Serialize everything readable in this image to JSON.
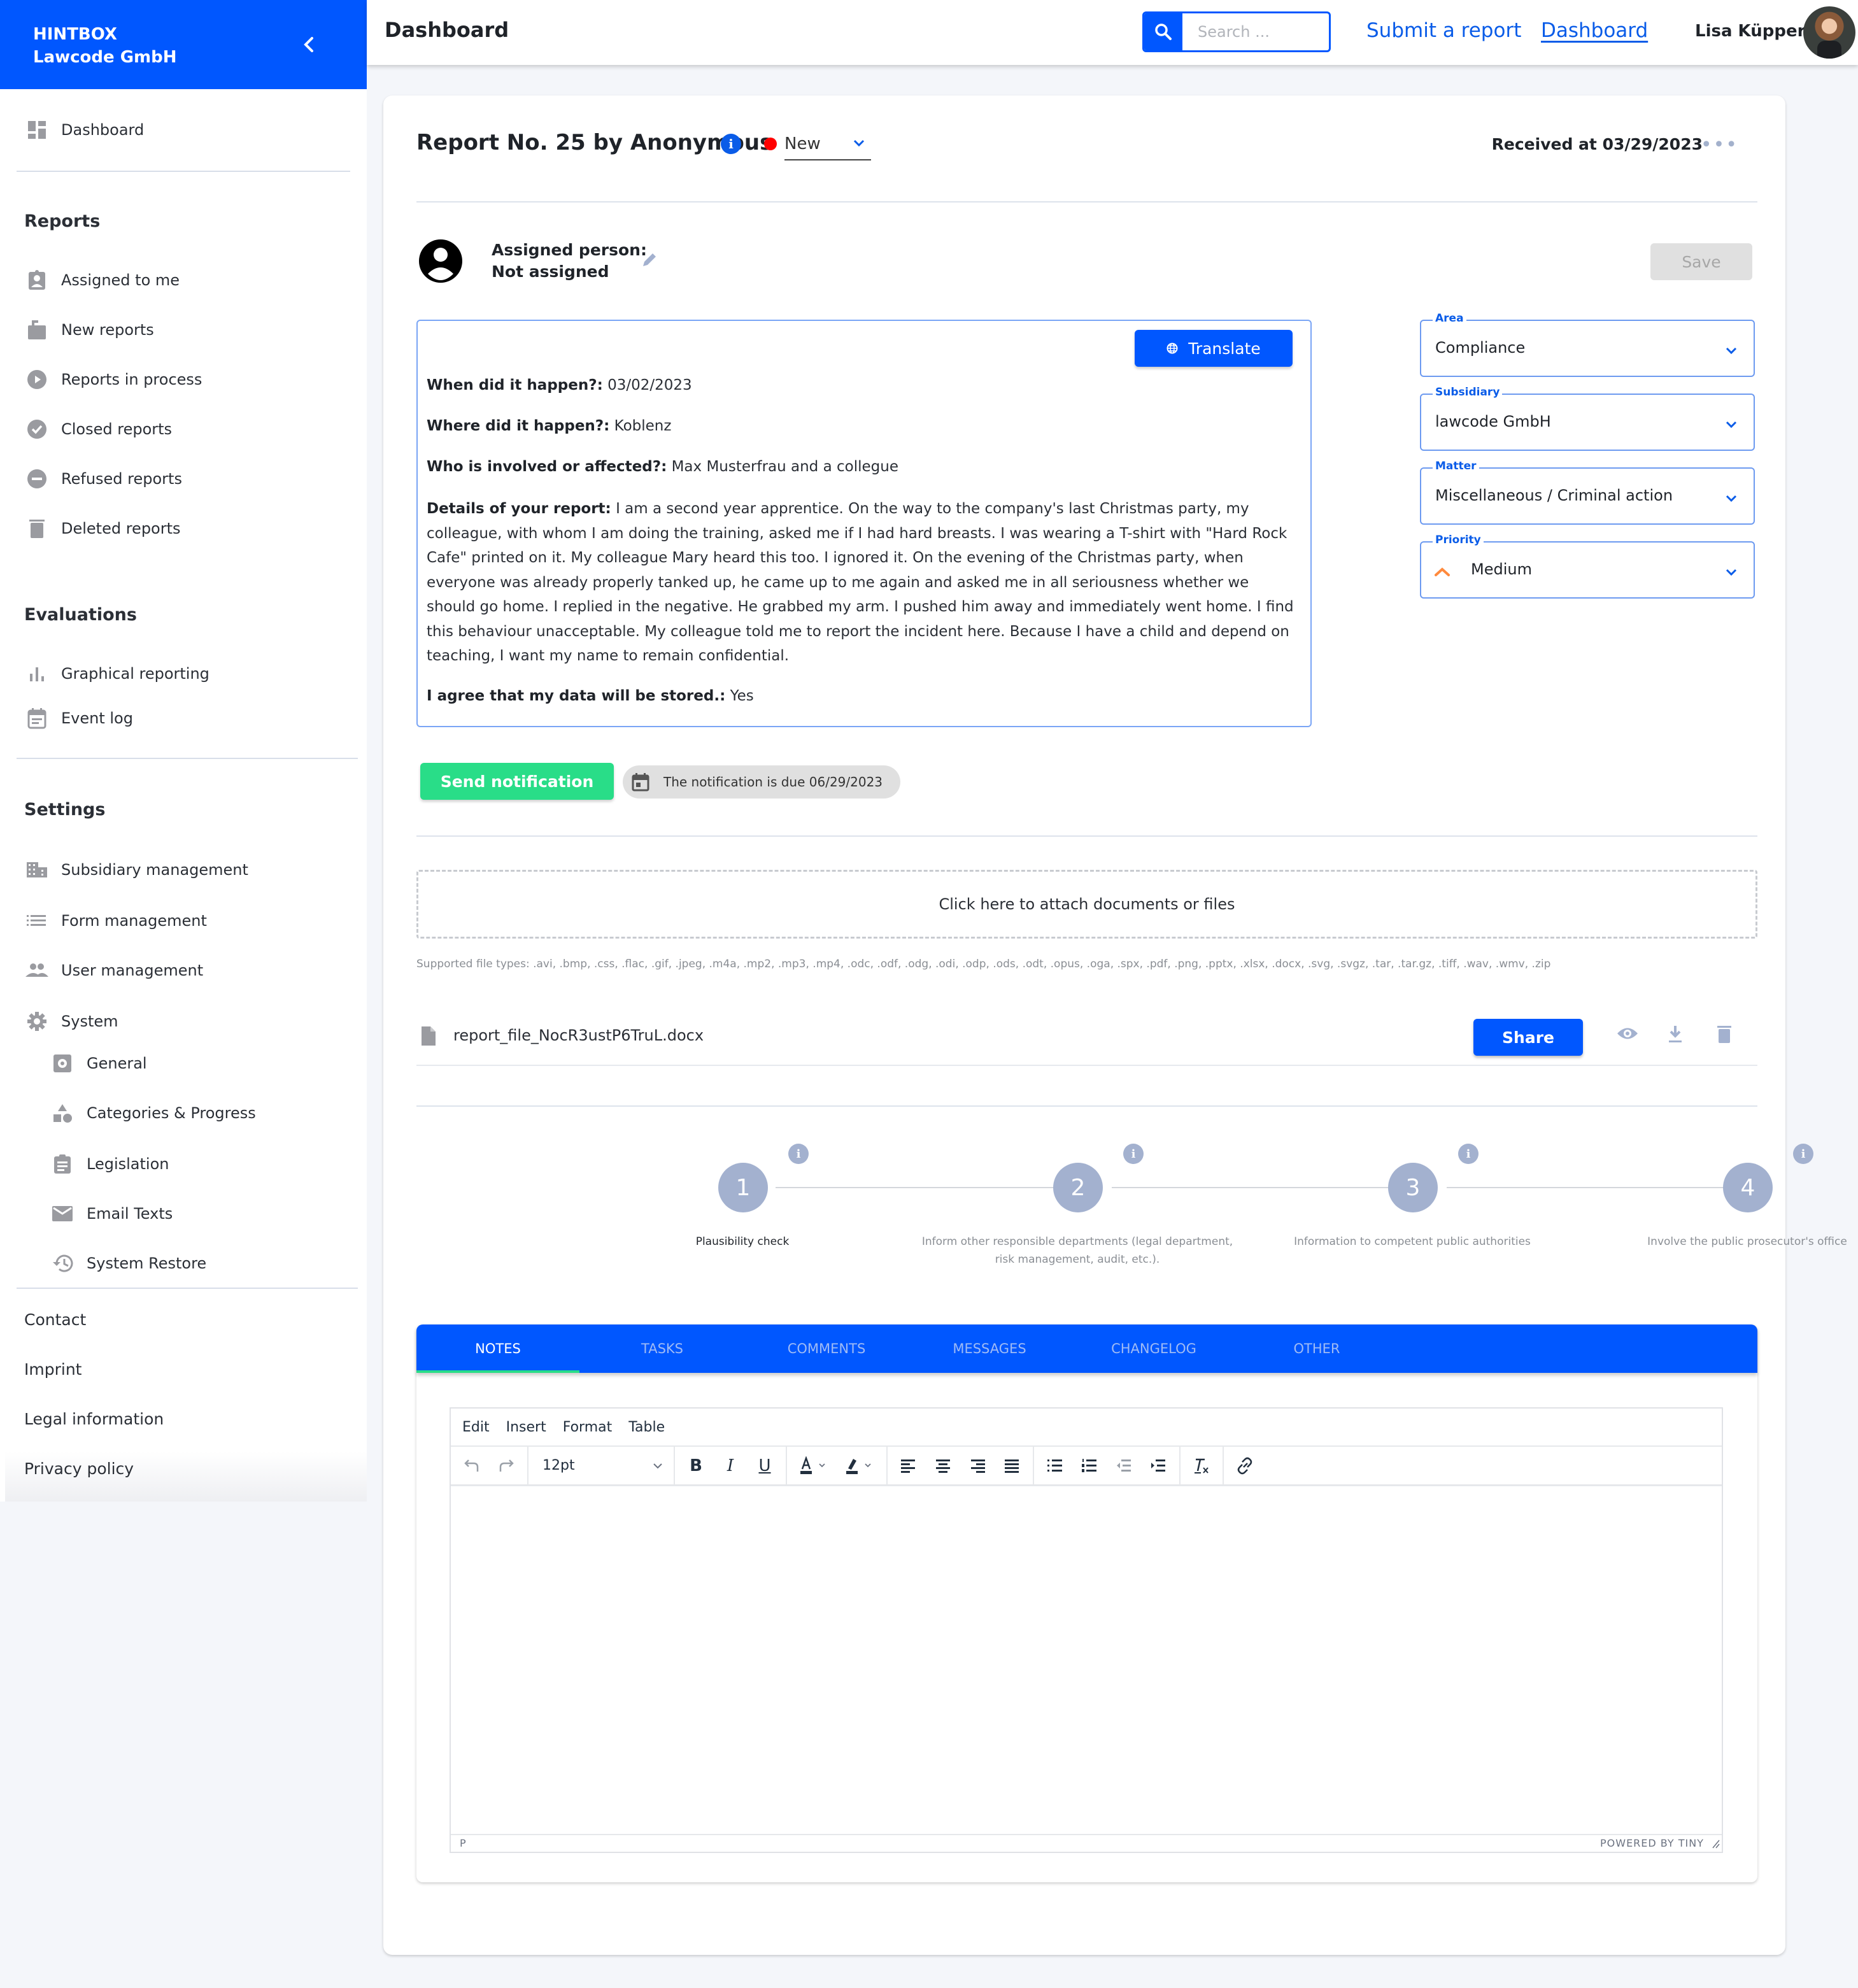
{
  "sidebar": {
    "brand": "HINTBOX",
    "company": "Lawcode GmbH",
    "dashboard": "Dashboard",
    "sections": {
      "reports": "Reports",
      "evaluations": "Evaluations",
      "settings": "Settings"
    },
    "reports_items": [
      {
        "label": "Assigned to me",
        "icon": "assignment-ind-icon"
      },
      {
        "label": "New reports",
        "icon": "new-report-icon"
      },
      {
        "label": "Reports in process",
        "icon": "play-circle-icon"
      },
      {
        "label": "Closed reports",
        "icon": "check-circle-icon"
      },
      {
        "label": "Refused reports",
        "icon": "minus-circle-icon"
      },
      {
        "label": "Deleted reports",
        "icon": "trash-icon"
      }
    ],
    "evaluation_items": [
      {
        "label": "Graphical reporting",
        "icon": "bar-chart-icon"
      },
      {
        "label": "Event log",
        "icon": "event-note-icon"
      }
    ],
    "settings_items": [
      {
        "label": "Subsidiary management",
        "icon": "building-icon"
      },
      {
        "label": "Form management",
        "icon": "list-icon"
      },
      {
        "label": "User management",
        "icon": "people-icon"
      },
      {
        "label": "System",
        "icon": "gear-icon"
      }
    ],
    "system_items": [
      {
        "label": "General",
        "icon": "settings-box-icon"
      },
      {
        "label": "Categories & Progress",
        "icon": "shapes-icon"
      },
      {
        "label": "Legislation",
        "icon": "clipboard-icon"
      },
      {
        "label": "Email Texts",
        "icon": "mail-icon"
      },
      {
        "label": "System Restore",
        "icon": "history-icon"
      }
    ],
    "footer_links": [
      "Contact",
      "Imprint",
      "Legal information",
      "Privacy policy"
    ]
  },
  "topbar": {
    "title": "Dashboard",
    "search_placeholder": "Search ...",
    "links": [
      "Submit a report",
      "Dashboard"
    ],
    "user_name": "Lisa Küppers"
  },
  "report": {
    "title": "Report No. 25 by Anonymous",
    "status": "New",
    "status_color": "#ff0000",
    "received": "Received at 03/29/2023",
    "assigned_label": "Assigned person:",
    "assigned_value": "Not assigned",
    "save_label": "Save",
    "translate_label": "Translate",
    "answers": [
      {
        "q": "When did it happen?:",
        "a": "03/02/2023"
      },
      {
        "q": "Where did it happen?:",
        "a": "Koblenz"
      },
      {
        "q": "Who is involved or affected?:",
        "a": "Max Musterfrau and a collegue"
      },
      {
        "q": "Details of your report:",
        "a": "I am a second year apprentice. On the way to the company's last Christmas party, my colleague, with whom I am doing the training, asked me if I had hard breasts. I was wearing a T-shirt with \"Hard Rock Cafe\" printed on it. My colleague Mary heard this too. I ignored it. On the evening of the Christmas party, when everyone was already properly tanked up, he came up to me again and asked me in all seriousness whether we should go home. I replied in the negative. He grabbed my arm. I pushed him away and immediately went home. I find this behaviour unacceptable. My colleague told me to report the incident here. Because I have a child and depend on teaching, I want my name to remain confidential."
      },
      {
        "q": "I agree that my data will be stored.:",
        "a": "Yes"
      }
    ],
    "fields": [
      {
        "label": "Area",
        "value": "Compliance"
      },
      {
        "label": "Subsidiary",
        "value": "lawcode GmbH"
      },
      {
        "label": "Matter",
        "value": "Miscellaneous / Criminal action"
      },
      {
        "label": "Priority",
        "value": "Medium",
        "priority_color": "#ff8a3d"
      }
    ],
    "send_notification": "Send notification",
    "notification_due": "The notification is due 06/29/2023",
    "attach_text": "Click here to attach documents or files",
    "supported_types": "Supported file types: .avi, .bmp, .css, .flac, .gif, .jpeg, .m4a, .mp2, .mp3, .mp4, .odc, .odf, .odg, .odi, .odp, .ods, .odt, .opus, .oga, .spx, .pdf, .png, .pptx, .xlsx, .docx, .svg, .svgz, .tar, .tar.gz, .tiff, .wav, .wmv, .zip",
    "file": {
      "name": "report_file_NocR3ustP6TruL.docx",
      "share_label": "Share"
    },
    "steps": [
      {
        "number": "1",
        "label": "Plausibility check",
        "done": true
      },
      {
        "number": "2",
        "label": "Inform other responsible departments (legal department, risk management, audit, etc.).",
        "done": false
      },
      {
        "number": "3",
        "label": "Information to competent public authorities",
        "done": false
      },
      {
        "number": "4",
        "label": "Involve the public prosecutor's office",
        "done": false
      }
    ],
    "tabs": [
      "NOTES",
      "TASKS",
      "COMMENTS",
      "MESSAGES",
      "CHANGELOG",
      "OTHER"
    ],
    "active_tab": "NOTES"
  },
  "editor": {
    "menu": [
      "Edit",
      "Insert",
      "Format",
      "Table"
    ],
    "font_size": "12pt",
    "status_path": "P",
    "powered_by": "POWERED BY TINY"
  },
  "colors": {
    "brand_blue": "#0057ff",
    "success_green": "#29dd88",
    "step_gray": "#a3b1cf"
  }
}
